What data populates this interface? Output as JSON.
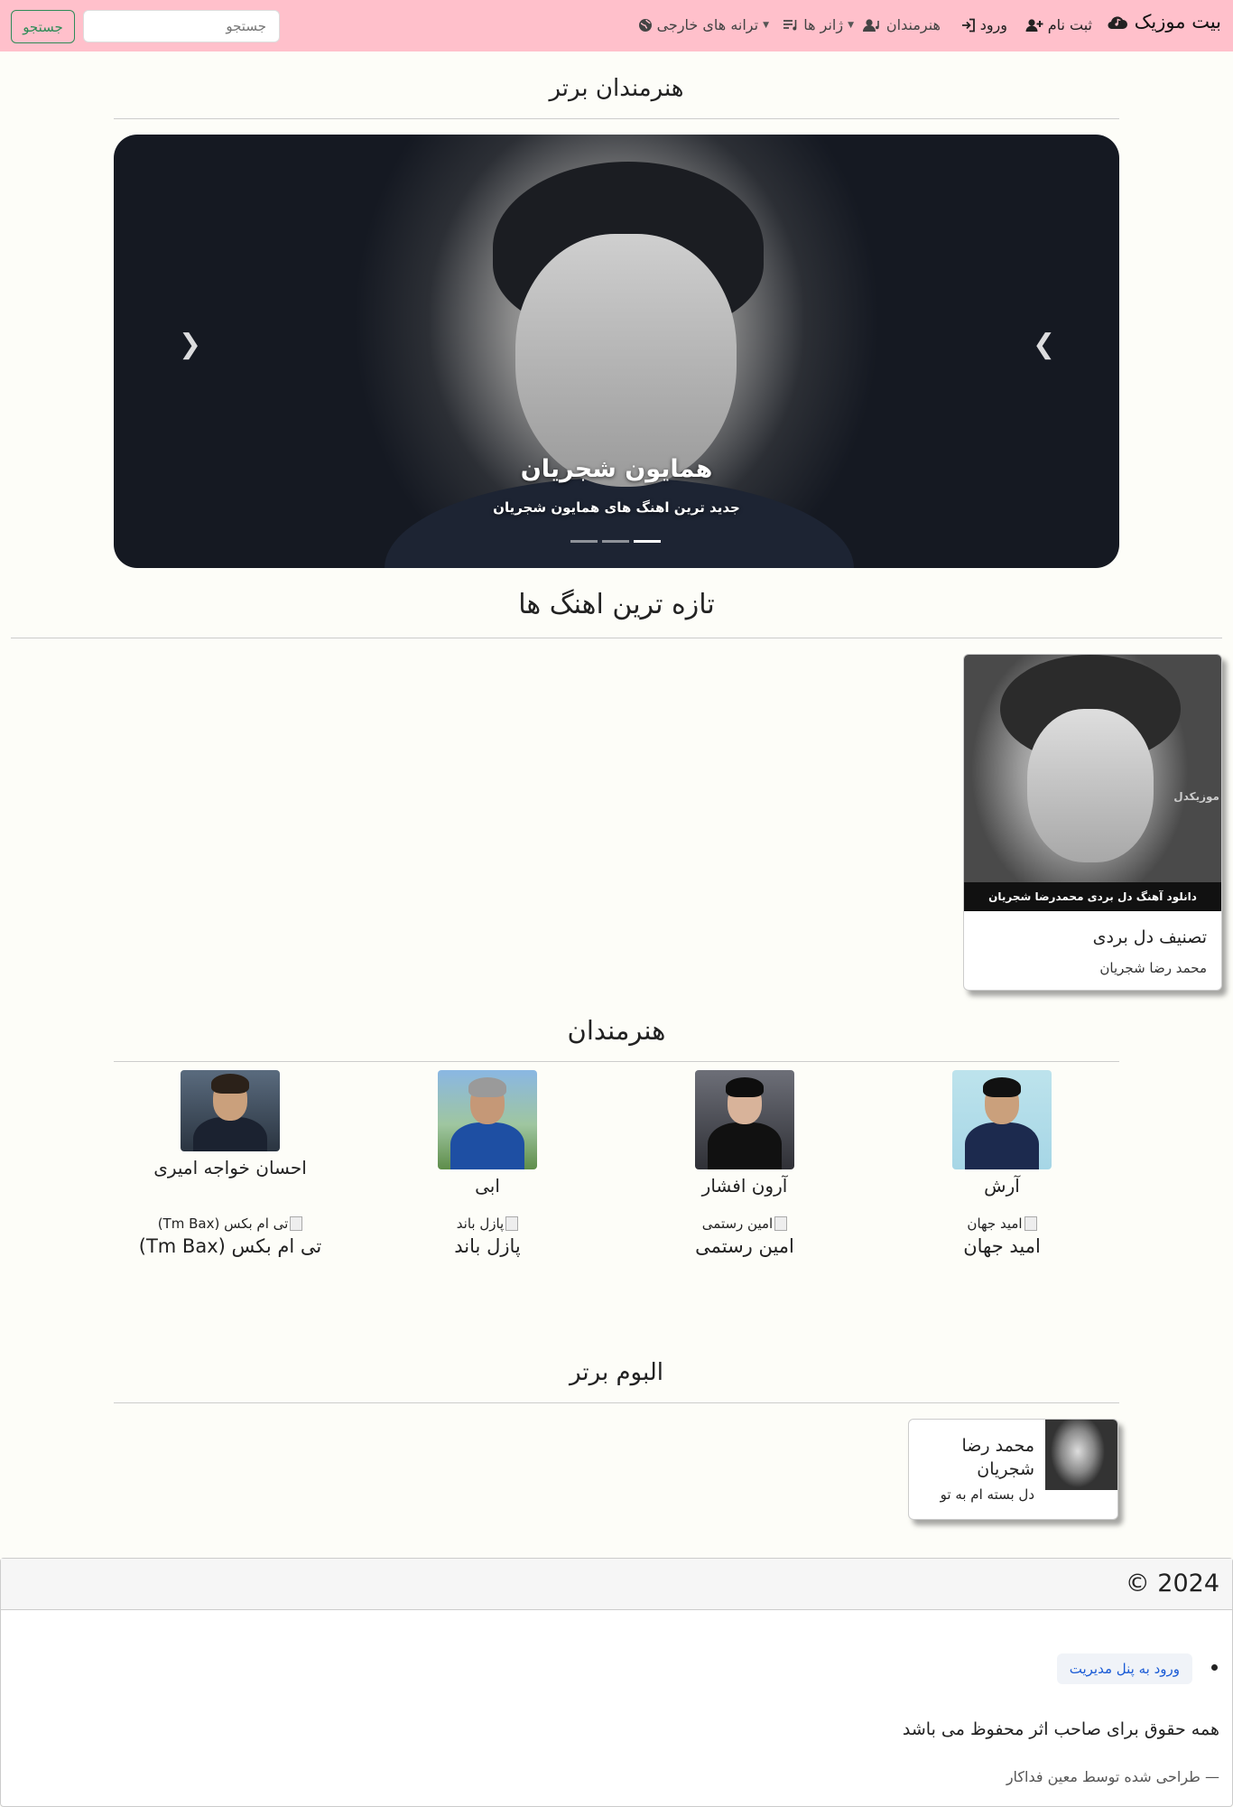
{
  "navbar": {
    "brand": "بیت موزیک",
    "items": [
      {
        "label": "ثبت نام",
        "icon": "user-plus-icon"
      },
      {
        "label": "ورود",
        "icon": "login-icon"
      },
      {
        "label": "هنرمندان",
        "icon": "users-music-icon"
      },
      {
        "label": "ژانر ها",
        "icon": "playlist-icon"
      },
      {
        "label": "ترانه های خارجی",
        "icon": "globe-icon"
      }
    ],
    "search_placeholder": "جستجو",
    "search_button": "جستجو",
    "accent_color": "#ffc0cb"
  },
  "top_artists": {
    "title": "هنرمندان برتر",
    "carousel": {
      "caption_title": "همایون شجریان",
      "caption_subtitle": "جدید ترین اهنگ های همایون شجریان",
      "slide_count": 3,
      "active_slide": 3
    }
  },
  "latest_songs": {
    "title": "تازه ترین اهنگ ها",
    "items": [
      {
        "image_banner": "دانلود آهنگ دل بردی محمدرضا شجریان",
        "image_watermark": "موزیکدل",
        "title": "تصنیف دل بردی",
        "artist": "محمد رضا شجریان"
      }
    ]
  },
  "artists": {
    "title": "هنرمندان",
    "row1": [
      {
        "name": "آرش"
      },
      {
        "name": "آرون افشار"
      },
      {
        "name": "ابی"
      },
      {
        "name": "احسان خواجه امیری"
      }
    ],
    "row2": [
      {
        "alt": "امید جهان",
        "name": "امید جهان"
      },
      {
        "alt": "امین رستمی",
        "name": "امین رستمی"
      },
      {
        "alt": "پازل باند",
        "name": "پازل باند"
      },
      {
        "alt": "تی ام بکس (Tm Bax)",
        "name": "تی ام بکس (Tm Bax)"
      }
    ]
  },
  "albums": {
    "title": "البوم برتر",
    "items": [
      {
        "artist": "محمد رضا شجریان",
        "title": "دل بسته ام به تو"
      }
    ]
  },
  "footer": {
    "year": "2024 ©",
    "admin_link": "ورود به پنل مدیریت",
    "rights": "همه حقوق برای صاحب اثر محفوظ می باشد",
    "credit": "— طراحی شده توسط معین فداکار"
  }
}
